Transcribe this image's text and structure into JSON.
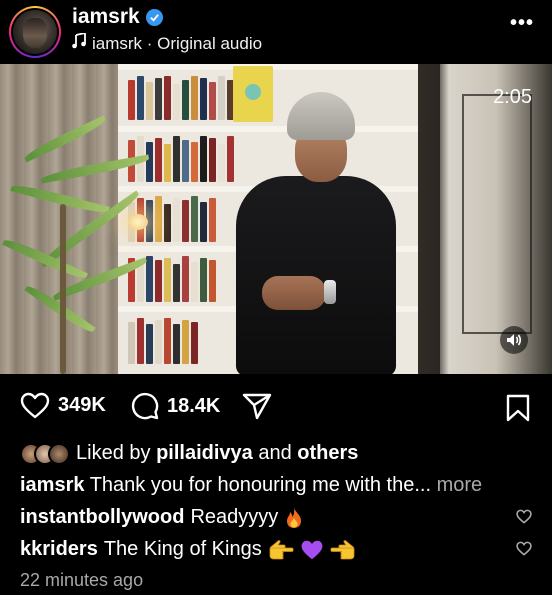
{
  "header": {
    "username": "iamsrk",
    "audio_label": "iamsrk · Original audio"
  },
  "video": {
    "timer": "2:05"
  },
  "actions": {
    "likes": "349K",
    "comments": "18.4K"
  },
  "liked_by": {
    "prefix": "Liked by",
    "user": "pillaidivya",
    "and": "and",
    "others": "others"
  },
  "caption": {
    "user": "iamsrk",
    "text": "Thank you for honouring me with the...",
    "more": "more"
  },
  "comments": [
    {
      "user": "instantbollywood",
      "text": "Readyyyy"
    },
    {
      "user": "kkriders",
      "text": "The King of Kings"
    }
  ],
  "time_ago": "22 minutes ago",
  "colors": {
    "background": "#000000",
    "text": "#ffffff",
    "muted": "#a8a8a8",
    "verified": "#3897f0"
  }
}
